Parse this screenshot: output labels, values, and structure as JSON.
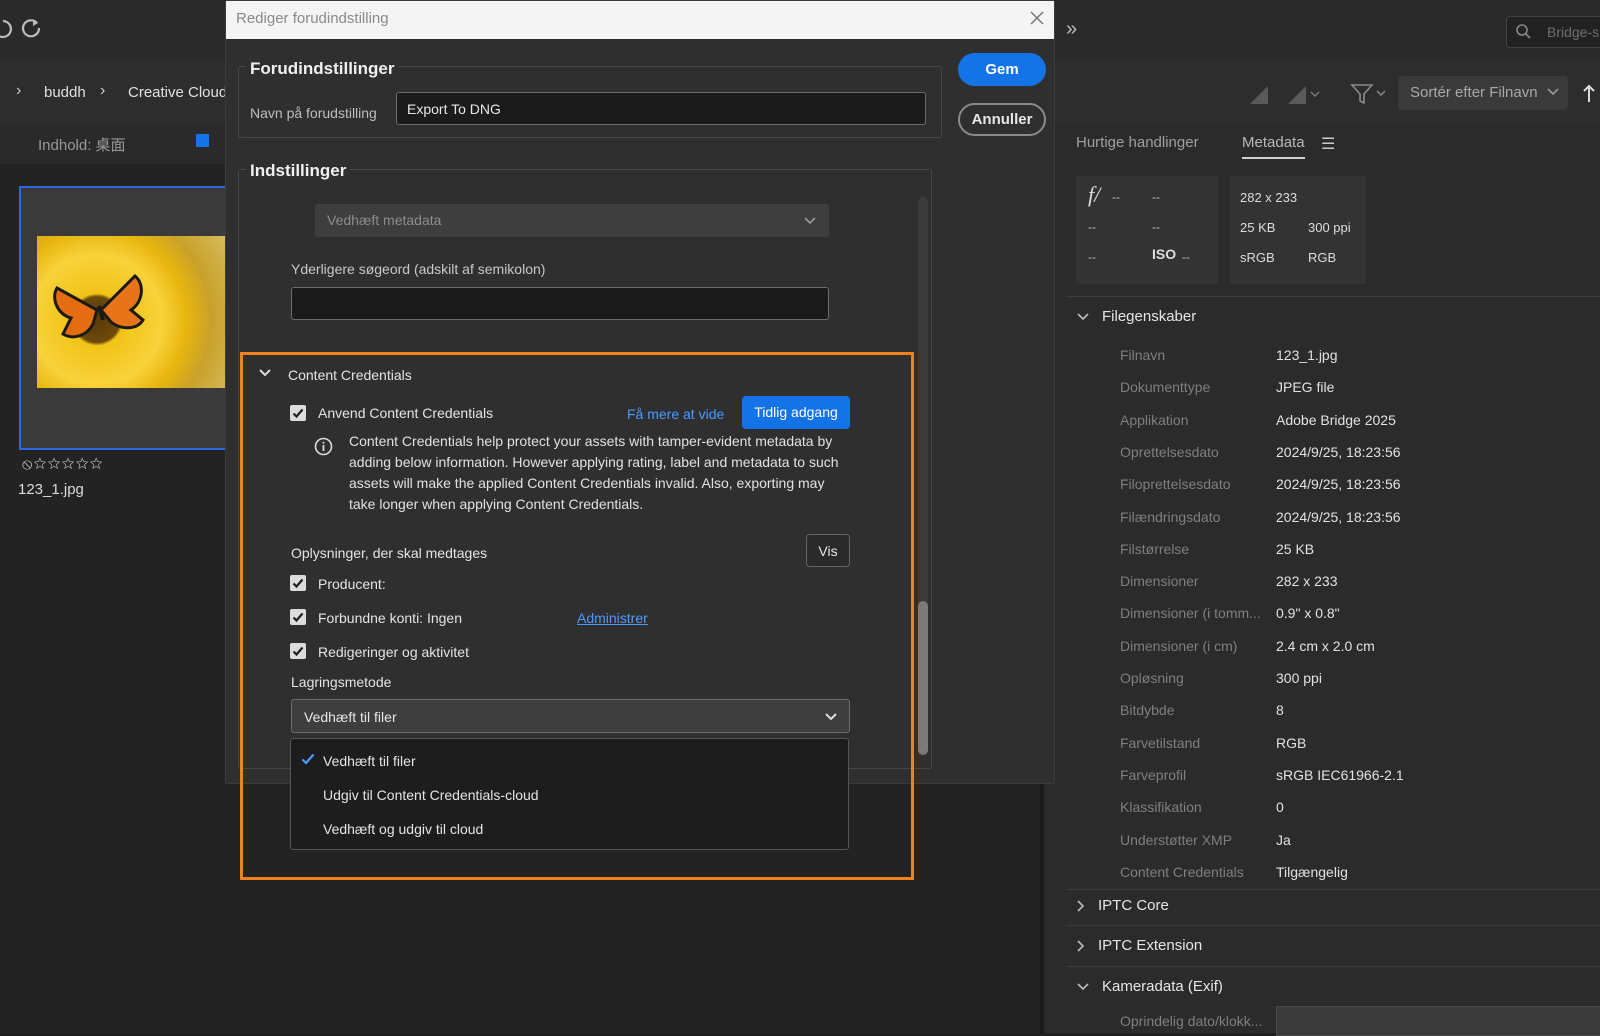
{
  "app": {
    "breadcrumb": [
      "buddh",
      "Creative Cloud F"
    ],
    "content_label": "Indhold: 桌面",
    "search_placeholder": "Bridge-sø",
    "sort_label": "Sortér efter Filnavn",
    "thumbnail": {
      "filename": "123_1.jpg",
      "rating": "0 of 5 stars"
    },
    "tabs": {
      "quick_actions": "Hurtige handlinger",
      "metadata": "Metadata"
    }
  },
  "metadata_summary": {
    "aperture": "f/",
    "dash": "--",
    "iso": "ISO",
    "dimensions": "282 x 233",
    "size": "25 KB",
    "ppi": "300 ppi",
    "profile": "sRGB",
    "mode": "RGB"
  },
  "file_properties": {
    "title": "Filegenskaber",
    "rows": [
      {
        "label": "Filnavn",
        "value": "123_1.jpg"
      },
      {
        "label": "Dokumenttype",
        "value": "JPEG file"
      },
      {
        "label": "Applikation",
        "value": "Adobe Bridge 2025"
      },
      {
        "label": "Oprettelsesdato",
        "value": "2024/9/25, 18:23:56"
      },
      {
        "label": "Filoprettelsesdato",
        "value": "2024/9/25, 18:23:56"
      },
      {
        "label": "Filændringsdato",
        "value": "2024/9/25, 18:23:56"
      },
      {
        "label": "Filstørrelse",
        "value": "25 KB"
      },
      {
        "label": "Dimensioner",
        "value": "282 x 233"
      },
      {
        "label": "Dimensioner (i tomm...",
        "value": "0.9\" x 0.8\""
      },
      {
        "label": "Dimensioner (i cm)",
        "value": "2.4 cm x 2.0 cm"
      },
      {
        "label": "Opløsning",
        "value": "300 ppi"
      },
      {
        "label": "Bitdybde",
        "value": "8"
      },
      {
        "label": "Farvetilstand",
        "value": "RGB"
      },
      {
        "label": "Farveprofil",
        "value": "sRGB IEC61966-2.1"
      },
      {
        "label": "Klassifikation",
        "value": "0"
      },
      {
        "label": "Understøtter XMP",
        "value": "Ja"
      },
      {
        "label": "Content Credentials",
        "value": "Tilgængelig"
      }
    ],
    "sections": [
      "IPTC Core",
      "IPTC Extension",
      "Kameradata (Exif)"
    ],
    "exif_first_row": "Oprindelig dato/klokk..."
  },
  "dialog": {
    "title": "Rediger forudindstilling",
    "presets_title": "Forudindstillinger",
    "preset_name_label": "Navn på forudstilling",
    "preset_name_value": "Export To DNG",
    "save": "Gem",
    "cancel": "Annuller",
    "settings_title": "Indstillinger",
    "metadata_select": "Vedhæft metadata",
    "keywords_label": "Yderligere søgeord (adskilt af semikolon)",
    "keywords_value": "",
    "cc_section": "Content Credentials",
    "apply_cc": "Anvend Content Credentials",
    "learn_more": "Få mere at vide",
    "early_access": "Tidlig adgang",
    "info_text": "Content Credentials help protect your assets with tamper-evident metadata by adding below information. However applying rating, label and metadata to such assets will make the applied Content Credentials invalid. Also, exporting may take longer when applying Content Credentials.",
    "include_label": "Oplysninger, der skal medtages",
    "view": "Vis",
    "producer": "Producent:",
    "connected_accounts": "Forbundne konti: Ingen",
    "manage": "Administrer",
    "edits": "Redigeringer og aktivitet",
    "storage_label": "Lagringsmetode",
    "storage_selected": "Vedhæft til filer",
    "storage_options": [
      "Vedhæft til filer",
      "Udgiv til Content Credentials-cloud",
      "Vedhæft og udgiv til cloud"
    ]
  },
  "colors": {
    "accent": "#1473e6",
    "highlight": "#f0821e"
  }
}
